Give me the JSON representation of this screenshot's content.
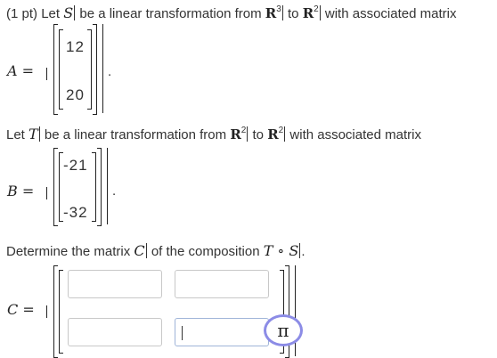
{
  "problem": {
    "points": "(1 pt)",
    "line1_a": "Let",
    "var_S": "S",
    "line1_b": "be a linear transformation from",
    "R": "R",
    "exp3": "3",
    "to": "to",
    "exp2": "2",
    "line1_c": "with associated matrix",
    "line2_a": "Let",
    "var_T": "T",
    "line2_b": "be a linear transformation from",
    "line2_c": "with associated matrix",
    "line3_a": "Determine the matrix",
    "var_C": "C",
    "line3_b": "of the composition",
    "compose": "T ∘ S",
    "period": "."
  },
  "matrix_A": {
    "label": "A =",
    "rows": [
      "12",
      "20"
    ]
  },
  "matrix_B": {
    "label": "B =",
    "rows": [
      "-21",
      "-32"
    ]
  },
  "matrix_C": {
    "label": "C =",
    "inputs": [
      {
        "value": "",
        "placeholder": ""
      },
      {
        "value": "",
        "placeholder": ""
      },
      {
        "value": "",
        "placeholder": ""
      },
      {
        "value": "",
        "placeholder": ""
      }
    ]
  },
  "pi_button": {
    "label": "π"
  },
  "colors": {
    "accent": "#8c8ce6",
    "text": "#333333",
    "input_border": "#c8c8c8",
    "focus_border": "#9fb4d8"
  }
}
